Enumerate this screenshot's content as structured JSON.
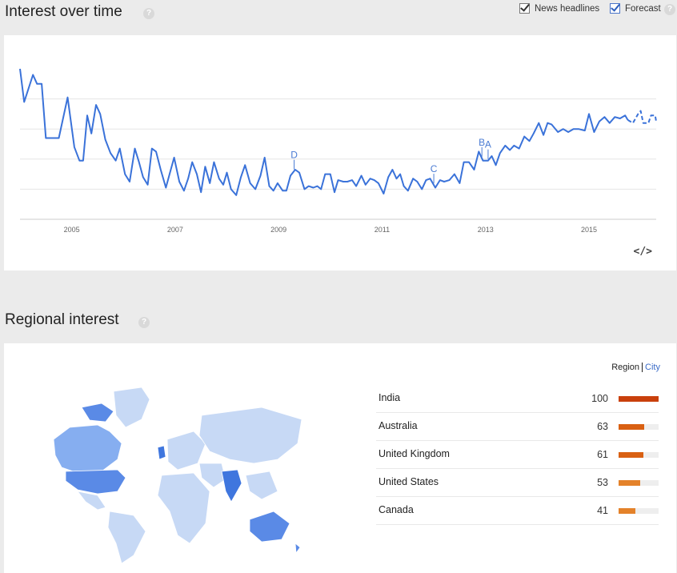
{
  "interest": {
    "title": "Interest over time",
    "options": {
      "news": "News headlines",
      "forecast": "Forecast"
    },
    "embed": "</>"
  },
  "chart_data": {
    "type": "line",
    "x_ticks": [
      "2005",
      "2007",
      "2009",
      "2011",
      "2013",
      "2015"
    ],
    "x_range": [
      2004.0,
      2016.3
    ],
    "ylim": [
      0,
      100
    ],
    "series": [
      {
        "values": [
          [
            2004.0,
            100
          ],
          [
            2004.08,
            78
          ],
          [
            2004.25,
            96
          ],
          [
            2004.33,
            90
          ],
          [
            2004.42,
            90
          ],
          [
            2004.5,
            54
          ],
          [
            2004.75,
            54
          ],
          [
            2004.92,
            81
          ],
          [
            2005.05,
            48
          ],
          [
            2005.15,
            39
          ],
          [
            2005.22,
            39
          ],
          [
            2005.3,
            69
          ],
          [
            2005.38,
            57
          ],
          [
            2005.47,
            76
          ],
          [
            2005.55,
            70
          ],
          [
            2005.65,
            53
          ],
          [
            2005.75,
            44
          ],
          [
            2005.85,
            39
          ],
          [
            2005.93,
            47
          ],
          [
            2006.03,
            30
          ],
          [
            2006.12,
            25
          ],
          [
            2006.22,
            47
          ],
          [
            2006.3,
            38
          ],
          [
            2006.38,
            28
          ],
          [
            2006.47,
            23
          ],
          [
            2006.55,
            47
          ],
          [
            2006.63,
            45
          ],
          [
            2006.72,
            33
          ],
          [
            2006.82,
            21
          ],
          [
            2006.9,
            31
          ],
          [
            2006.98,
            41
          ],
          [
            2007.08,
            25
          ],
          [
            2007.17,
            19
          ],
          [
            2007.25,
            27
          ],
          [
            2007.33,
            38
          ],
          [
            2007.42,
            30
          ],
          [
            2007.5,
            18
          ],
          [
            2007.58,
            35
          ],
          [
            2007.67,
            24
          ],
          [
            2007.75,
            38
          ],
          [
            2007.85,
            27
          ],
          [
            2007.93,
            23
          ],
          [
            2008.0,
            31
          ],
          [
            2008.08,
            20
          ],
          [
            2008.18,
            16
          ],
          [
            2008.27,
            28
          ],
          [
            2008.35,
            36
          ],
          [
            2008.45,
            24
          ],
          [
            2008.55,
            20
          ],
          [
            2008.65,
            29
          ],
          [
            2008.73,
            41
          ],
          [
            2008.82,
            22
          ],
          [
            2008.9,
            19
          ],
          [
            2008.98,
            24
          ],
          [
            2009.08,
            19
          ],
          [
            2009.15,
            19
          ],
          [
            2009.23,
            29
          ],
          [
            2009.32,
            33
          ],
          [
            2009.4,
            31
          ],
          [
            2009.5,
            20
          ],
          [
            2009.58,
            22
          ],
          [
            2009.67,
            21
          ],
          [
            2009.75,
            22
          ],
          [
            2009.82,
            20
          ],
          [
            2009.9,
            30
          ],
          [
            2010.0,
            30
          ],
          [
            2010.08,
            18
          ],
          [
            2010.15,
            26
          ],
          [
            2010.25,
            25
          ],
          [
            2010.33,
            25
          ],
          [
            2010.42,
            26
          ],
          [
            2010.5,
            22
          ],
          [
            2010.6,
            29
          ],
          [
            2010.68,
            23
          ],
          [
            2010.77,
            27
          ],
          [
            2010.85,
            26
          ],
          [
            2010.93,
            24
          ],
          [
            2011.03,
            17
          ],
          [
            2011.12,
            28
          ],
          [
            2011.2,
            33
          ],
          [
            2011.28,
            27
          ],
          [
            2011.35,
            30
          ],
          [
            2011.42,
            22
          ],
          [
            2011.5,
            19
          ],
          [
            2011.6,
            27
          ],
          [
            2011.68,
            25
          ],
          [
            2011.77,
            20
          ],
          [
            2011.85,
            26
          ],
          [
            2011.93,
            27
          ],
          [
            2012.03,
            21
          ],
          [
            2012.12,
            26
          ],
          [
            2012.2,
            25
          ],
          [
            2012.3,
            26
          ],
          [
            2012.4,
            30
          ],
          [
            2012.5,
            24
          ],
          [
            2012.58,
            38
          ],
          [
            2012.68,
            38
          ],
          [
            2012.78,
            33
          ],
          [
            2012.87,
            45
          ],
          [
            2012.95,
            39
          ],
          [
            2013.05,
            39
          ],
          [
            2013.12,
            42
          ],
          [
            2013.2,
            36
          ],
          [
            2013.28,
            44
          ],
          [
            2013.38,
            49
          ],
          [
            2013.47,
            46
          ],
          [
            2013.55,
            49
          ],
          [
            2013.65,
            47
          ],
          [
            2013.75,
            55
          ],
          [
            2013.85,
            52
          ],
          [
            2013.93,
            57
          ],
          [
            2014.03,
            64
          ],
          [
            2014.12,
            56
          ],
          [
            2014.2,
            64
          ],
          [
            2014.28,
            63
          ],
          [
            2014.4,
            58
          ],
          [
            2014.5,
            60
          ],
          [
            2014.6,
            58
          ],
          [
            2014.7,
            60
          ],
          [
            2014.8,
            60
          ],
          [
            2014.92,
            59
          ],
          [
            2015.0,
            70
          ],
          [
            2015.1,
            58
          ],
          [
            2015.2,
            65
          ],
          [
            2015.3,
            68
          ],
          [
            2015.4,
            64
          ],
          [
            2015.5,
            68
          ],
          [
            2015.6,
            67
          ],
          [
            2015.7,
            69
          ],
          [
            2015.75,
            66
          ]
        ]
      },
      {
        "values": [
          [
            2015.75,
            66
          ],
          [
            2015.85,
            64
          ],
          [
            2015.95,
            70
          ],
          [
            2016.0,
            72
          ],
          [
            2016.05,
            64
          ],
          [
            2016.15,
            64
          ],
          [
            2016.2,
            69
          ],
          [
            2016.28,
            69
          ],
          [
            2016.3,
            65
          ]
        ]
      }
    ],
    "markers": [
      {
        "label": "D",
        "x": 2009.3
      },
      {
        "label": "C",
        "x": 2012.0
      },
      {
        "label": "B",
        "x": 2012.93
      },
      {
        "label": "A",
        "x": 2013.05
      }
    ],
    "colors": {
      "line": "#3a72d9",
      "grid": "#e5e5e5",
      "axis": "#cccccc",
      "marker": "#4a7bd3",
      "tick_label": "#666666"
    }
  },
  "regional": {
    "title": "Regional interest",
    "toggle": {
      "region": "Region",
      "city": "City"
    },
    "rows": [
      {
        "name": "India",
        "value": "100",
        "fraction": 1.0,
        "color": "#c9400c"
      },
      {
        "name": "Australia",
        "value": "63",
        "fraction": 0.63,
        "color": "#d96012"
      },
      {
        "name": "United Kingdom",
        "value": "61",
        "fraction": 0.61,
        "color": "#d96012"
      },
      {
        "name": "United States",
        "value": "53",
        "fraction": 0.53,
        "color": "#e4822a"
      },
      {
        "name": "Canada",
        "value": "41",
        "fraction": 0.41,
        "color": "#e4822a"
      }
    ],
    "map_colors": {
      "light": "#c7d9f5",
      "mid": "#86aef0",
      "dark": "#5a8ae6",
      "darkest": "#3f76de"
    }
  },
  "help_glyph": "?"
}
